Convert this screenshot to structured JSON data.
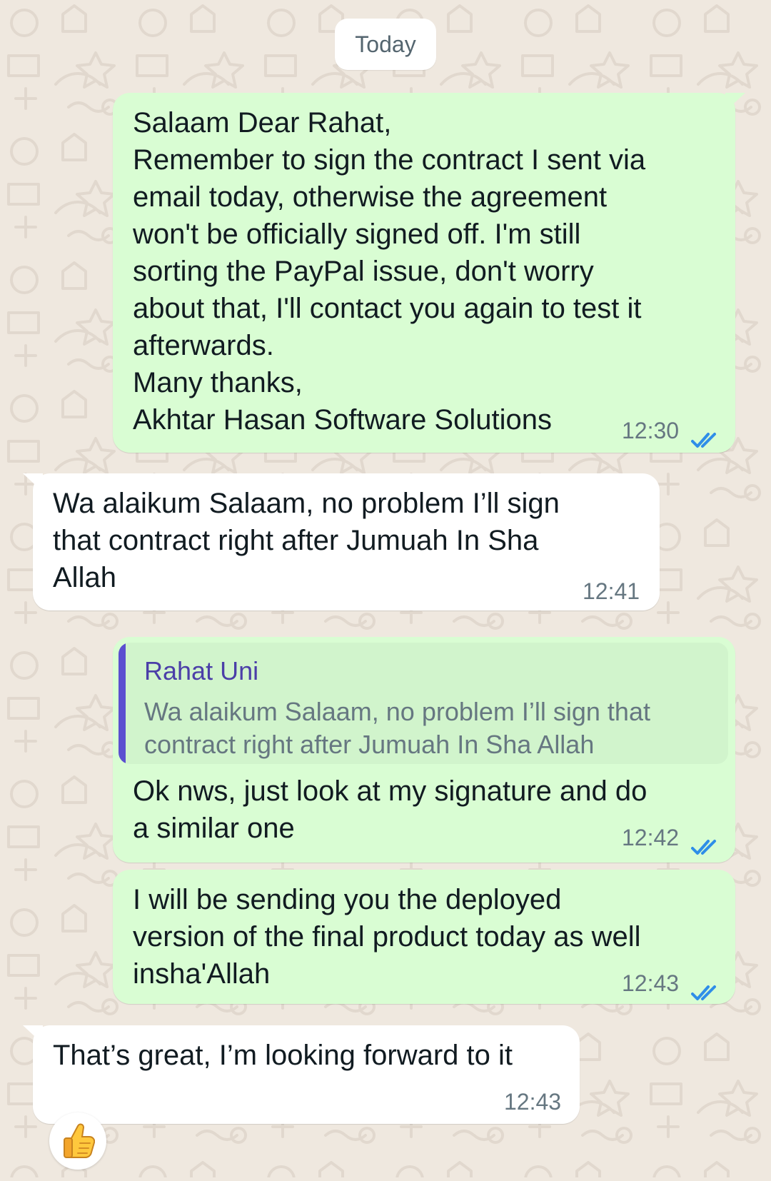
{
  "chat": {
    "date_separator": "Today",
    "messages": [
      {
        "direction": "outgoing",
        "text": "Salaam Dear Rahat,\nRemember to sign the contract I sent via\nemail today, otherwise the agreement\nwon't be officially signed off. I'm still\nsorting the PayPal issue, don't worry\nabout that, I'll contact you again to test it\nafterwards.\nMany thanks,\nAkhtar Hasan Software Solutions",
        "time": "12:30",
        "status": "read"
      },
      {
        "direction": "incoming",
        "text": "Wa alaikum Salaam, no problem I’ll sign\nthat contract right after Jumuah In Sha\nAllah",
        "time": "12:41"
      },
      {
        "direction": "outgoing",
        "quoted_author": "Rahat Uni",
        "quoted_text": "Wa alaikum Salaam, no problem I’ll sign that\ncontract right after Jumuah In Sha Allah",
        "text": "Ok nws, just look at my signature and do\na similar one",
        "time": "12:42",
        "status": "read"
      },
      {
        "direction": "outgoing",
        "text": "I will be sending you the deployed\nversion of the final product today as well\ninsha'Allah",
        "time": "12:43",
        "status": "read"
      },
      {
        "direction": "incoming",
        "text": "That’s great, I’m looking forward to it",
        "time": "12:43",
        "reaction": "👍"
      }
    ]
  },
  "colors": {
    "background": "#efe8df",
    "outgoing_bubble": "#d9fdd3",
    "incoming_bubble": "#ffffff",
    "read_ticks": "#2f8ee8",
    "quote_accent": "#5b4fd0",
    "quote_author": "#4b3ea8"
  },
  "icons": {
    "read_receipt": "double-check-icon",
    "reaction": "thumbs-up-emoji"
  }
}
